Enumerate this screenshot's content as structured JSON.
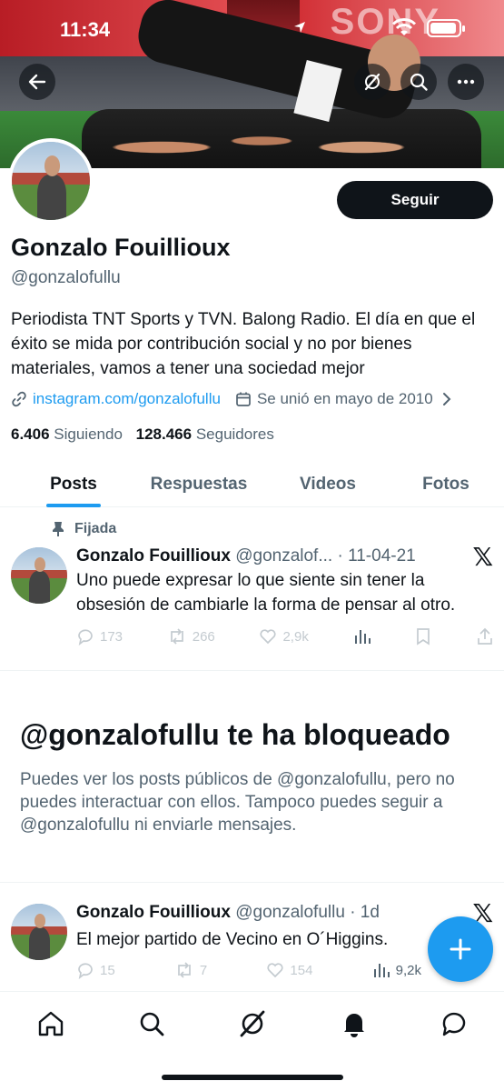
{
  "status": {
    "time": "11:34"
  },
  "banner": {
    "sign_text": "SONY"
  },
  "profile": {
    "follow_label": "Seguir",
    "name": "Gonzalo Fouillioux",
    "handle": "@gonzalofullu",
    "bio": "Periodista TNT Sports y TVN. Balong Radio. El día en que el éxito se mida por contribución social y no por bienes materiales, vamos a tener una sociedad mejor",
    "link": "instagram.com/gonzalofullu",
    "joined": "Se unió en mayo de 2010",
    "following_count": "6.406",
    "following_label": "Siguiendo",
    "followers_count": "128.466",
    "followers_label": "Seguidores"
  },
  "tabs": [
    {
      "label": "Posts",
      "active": true
    },
    {
      "label": "Respuestas"
    },
    {
      "label": "Videos"
    },
    {
      "label": "Fotos"
    }
  ],
  "pinned_tweet": {
    "pinned_label": "Fijada",
    "name": "Gonzalo Fouillioux",
    "handle": "@gonzalof...",
    "date": "· 11-04-21",
    "text": "Uno puede expresar lo que siente sin tener la obsesión de cambiarle la forma de pensar al otro.",
    "replies": "173",
    "reposts": "266",
    "likes": "2,9k"
  },
  "blocked": {
    "title": "@gonzalofullu te ha bloqueado",
    "text": "Puedes ver los posts públicos de @gonzalofullu, pero no puedes interactuar con ellos. Tampoco puedes seguir a @gonzalofullu ni enviarle mensajes."
  },
  "tweet2": {
    "name": "Gonzalo Fouillioux",
    "handle": "@gonzalofullu",
    "date": "· 1d",
    "text": "El mejor partido de Vecino en O´Higgins.",
    "replies": "15",
    "reposts": "7",
    "likes": "154",
    "views": "9,2k"
  },
  "colors": {
    "accent": "#1d9bf0",
    "text": "#0f1419",
    "muted": "#536471"
  }
}
